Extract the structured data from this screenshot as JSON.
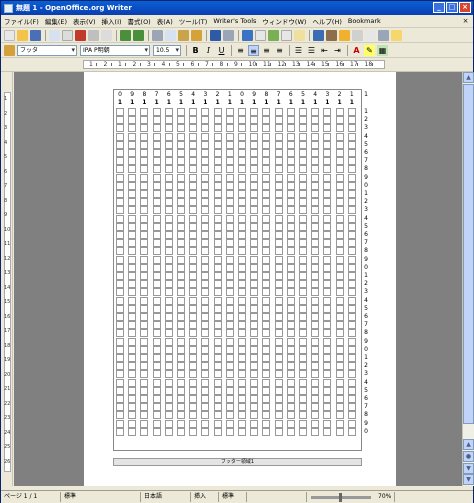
{
  "window": {
    "title": "無題 1 - OpenOffice.org Writer"
  },
  "menu": {
    "items": [
      "ファイル(F)",
      "編集(E)",
      "表示(V)",
      "挿入(I)",
      "書式(O)",
      "表(A)",
      "ツール(T)",
      "Writer's Tools",
      "ウィンドウ(W)",
      "ヘルプ(H)",
      "Bookmark"
    ]
  },
  "format_toolbar": {
    "style": "フッタ",
    "font": "IPA P明朝",
    "size": "10.5"
  },
  "ruler": {
    "numbers": [
      "1",
      "2",
      "1",
      "2",
      "3",
      "4",
      "5",
      "6",
      "7",
      "8",
      "9",
      "10",
      "11",
      "12",
      "13",
      "14",
      "15",
      "16",
      "17",
      "18"
    ]
  },
  "vruler": {
    "numbers": [
      "1",
      "2",
      "3",
      "4",
      "5",
      "6",
      "7",
      "8",
      "9",
      "10",
      "11",
      "12",
      "13",
      "14",
      "15",
      "16",
      "17",
      "18",
      "19",
      "20",
      "21",
      "22",
      "23",
      "24",
      "25",
      "26"
    ]
  },
  "grid": {
    "header_numbers": [
      "0",
      "9",
      "8",
      "7",
      "6",
      "5",
      "4",
      "3",
      "2",
      "1",
      "0",
      "9",
      "8",
      "7",
      "6",
      "5",
      "4",
      "3",
      "2",
      "1"
    ],
    "header_marks": [
      "1",
      "1",
      "1",
      "1",
      "1",
      "1",
      "1",
      "1",
      "1",
      "1",
      "1",
      "1",
      "1",
      "1",
      "1",
      "1",
      "1",
      "1",
      "1",
      "1"
    ],
    "row_numbers": [
      "1",
      "2",
      "3",
      "4",
      "5",
      "6",
      "7",
      "8",
      "9",
      "0",
      "1",
      "2",
      "3",
      "4",
      "5",
      "6",
      "7",
      "8",
      "9",
      "0",
      "1",
      "2",
      "3",
      "4",
      "5",
      "6",
      "7",
      "8",
      "9",
      "0",
      "1",
      "2",
      "3",
      "4",
      "5",
      "6",
      "7",
      "8",
      "9",
      "0"
    ]
  },
  "footer": {
    "text": "フッター領域1"
  },
  "status": {
    "page": "ページ 1 / 1",
    "style": "標準",
    "language": "日本語",
    "insert": "挿入",
    "mode": "標準",
    "zoom": "70%"
  }
}
